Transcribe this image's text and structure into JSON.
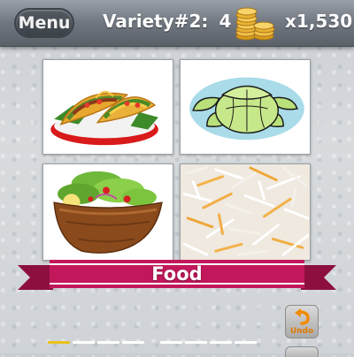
{
  "header": {
    "menu_label": "Menu",
    "level_label": "Variety#2:",
    "level_number": "4",
    "coins": "x1,530"
  },
  "tiles": [
    {
      "subject": "tacos"
    },
    {
      "subject": "lettuce"
    },
    {
      "subject": "salad"
    },
    {
      "subject": "shredded cheese"
    }
  ],
  "banner": {
    "label": "Food",
    "color": "#c2185b"
  },
  "answer_slots": {
    "count": 8,
    "filled": 0,
    "active_index": 0
  },
  "undo": {
    "label": "Undo"
  },
  "colors": {
    "accent_yellow": "#e8c21c",
    "banner_pink": "#c2185b",
    "undo_orange": "#e07a00"
  }
}
